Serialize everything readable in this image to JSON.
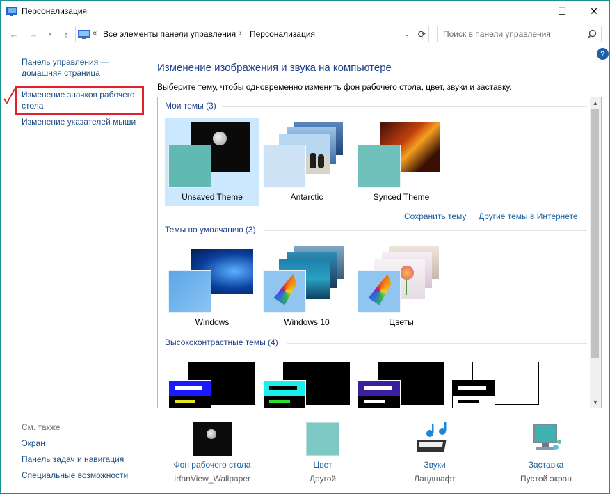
{
  "window": {
    "title": "Персонализация",
    "minimize": "—",
    "maximize": "☐",
    "close": "✕"
  },
  "addressbar": {
    "overflow": "«",
    "crumb1": "Все элементы панели управления",
    "sep": "›",
    "crumb2": "Персонализация",
    "search_placeholder": "Поиск в панели управления"
  },
  "left": {
    "home_link": "Панель управления — домашняя страница",
    "link_icons": "Изменение значков рабочего стола",
    "link_pointers": "Изменение указателей мыши",
    "see_also": "См. также",
    "see_also_links": [
      "Экран",
      "Панель задач и навигация",
      "Специальные возможности"
    ]
  },
  "main": {
    "title": "Изменение изображения и звука на компьютере",
    "description": "Выберите тему, чтобы одновременно изменить фон рабочего стола, цвет, звуки и заставку."
  },
  "groups": {
    "my": {
      "header": "Мои темы (3)",
      "themes": [
        "Unsaved Theme",
        "Antarctic",
        "Synced Theme"
      ],
      "save_link": "Сохранить тему",
      "more_link": "Другие темы в Интернете"
    },
    "default": {
      "header": "Темы по умолчанию (3)",
      "themes": [
        "Windows",
        "Windows 10",
        "Цветы"
      ]
    },
    "contrast": {
      "header": "Высококонтрастные темы (4)"
    }
  },
  "bottom": [
    {
      "label": "Фон рабочего стола",
      "value": "IrfanView_Wallpaper"
    },
    {
      "label": "Цвет",
      "value": "Другой"
    },
    {
      "label": "Звуки",
      "value": "Ландшафт"
    },
    {
      "label": "Заставка",
      "value": "Пустой экран"
    }
  ],
  "colors": {
    "accent_link": "#1a4d82",
    "title_blue": "#1e3f8a",
    "selected_bg": "#cce8ff",
    "highlight_red": "#e0202a",
    "teal": "#5fb7b3"
  }
}
